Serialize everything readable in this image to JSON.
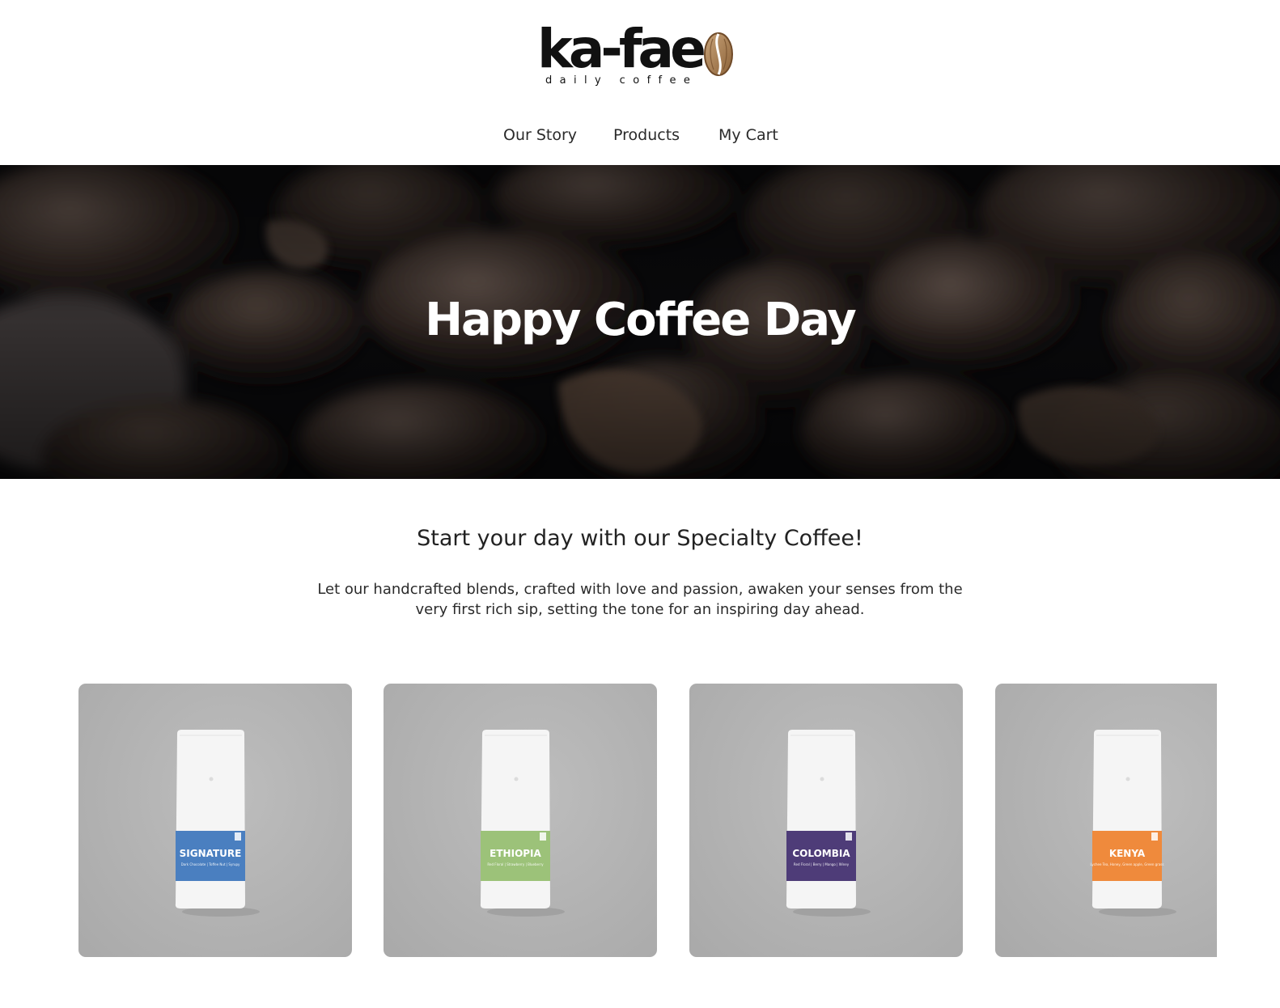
{
  "brand": {
    "wordmark": "ka-fae",
    "tagline": "daily coffee"
  },
  "nav": {
    "items": [
      {
        "label": "Our Story"
      },
      {
        "label": "Products"
      },
      {
        "label": "My Cart"
      }
    ]
  },
  "hero": {
    "title": "Happy Coffee Day"
  },
  "intro": {
    "heading": "Start your day with our Specialty Coffee!",
    "text": "Let our handcrafted blends, crafted with love and passion, awaken your senses from the very first rich sip, setting the tone for an inspiring day ahead."
  },
  "products": [
    {
      "name": "SIGNATURE",
      "notes": "Dark Chocolate | Toffee Nut | Syrupy",
      "label_color": "#4a7fc0"
    },
    {
      "name": "ETHIOPIA",
      "notes": "Red Floral | Strawberry | Blueberry",
      "label_color": "#9cc279"
    },
    {
      "name": "COLOMBIA",
      "notes": "Red Floral | Berry | Mango | Winey",
      "label_color": "#4e3c78"
    },
    {
      "name": "KENYA",
      "notes": "Lychee Tea, Honey, Green apple, Green grass",
      "label_color": "#ef8a3c"
    }
  ],
  "colors": {
    "hero_bg": "#08080a",
    "card_bg": "#b4b4b4",
    "text": "#222222"
  }
}
